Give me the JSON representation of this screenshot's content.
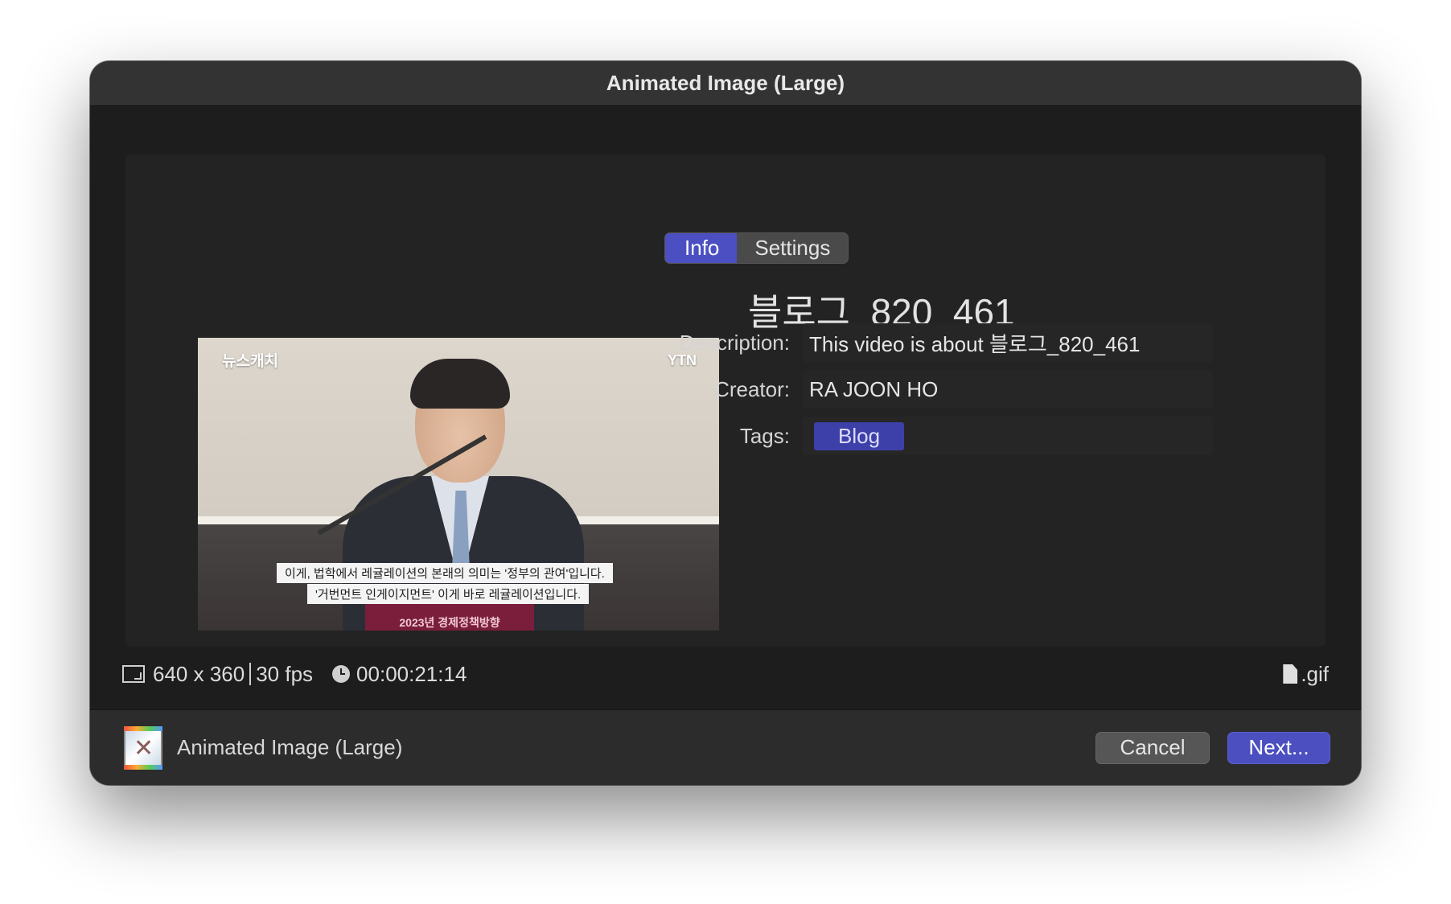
{
  "window": {
    "title": "Animated Image (Large)"
  },
  "tabs": [
    {
      "label": "Info",
      "active": true
    },
    {
      "label": "Settings",
      "active": false
    }
  ],
  "clip": {
    "name": "블로그_820_461"
  },
  "thumbnail": {
    "logo_left": "뉴스캐치",
    "logo_right": "YTN",
    "subtitle_line1": "이게, 법학에서 레귤레이션의 본래의 의미는 '정부의 관여'입니다.",
    "subtitle_line2": "'거번먼트 인게이지먼트' 이게 바로 레귤레이션입니다.",
    "podium_text": "2023년 경제정책방향"
  },
  "info": {
    "description_label": "Description:",
    "description_value": "This video is about 블로그_820_461",
    "creator_label": "Creator:",
    "creator_value": "RA JOON HO",
    "tags_label": "Tags:",
    "tags": [
      "Blog"
    ]
  },
  "status": {
    "dimensions": "640 x 360",
    "fps": "30 fps",
    "duration": "00:00:21:14",
    "file_type": ".gif"
  },
  "footer": {
    "preset_name": "Animated Image (Large)",
    "cancel_label": "Cancel",
    "next_label": "Next..."
  },
  "colors": {
    "accent": "#4b4fc0",
    "tag": "#3d40a8",
    "background": "#1d1d1d"
  }
}
